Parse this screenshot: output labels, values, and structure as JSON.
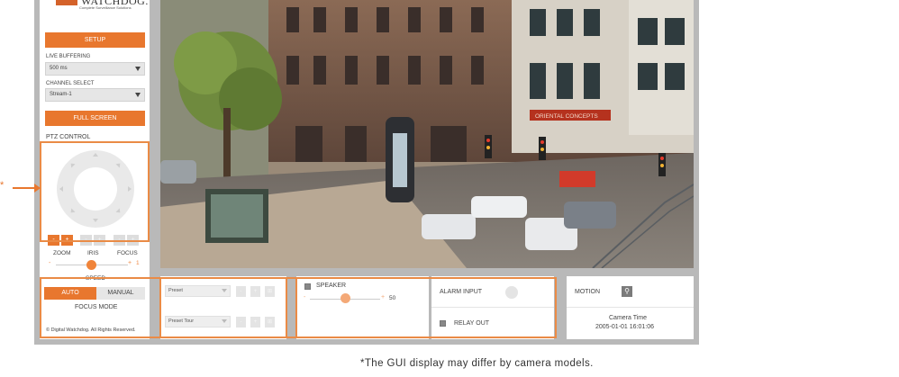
{
  "brand": {
    "name": "WATCHDOG.",
    "tagline": "Complete Surveillance Solutions"
  },
  "sidebar": {
    "setup_label": "SETUP",
    "live_buffering": {
      "label": "LIVE BUFFERING",
      "value": "500 ms"
    },
    "channel_select": {
      "label": "CHANNEL SELECT",
      "value": "Stream-1"
    },
    "fullscreen_label": "FULL SCREEN",
    "ptz_label": "PTZ CONTROL",
    "zoom": {
      "label": "ZOOM",
      "minus": "-",
      "plus": "+"
    },
    "iris": {
      "label": "IRIS",
      "minus": "-",
      "plus": "+"
    },
    "focus": {
      "label": "FOCUS",
      "minus": "-",
      "plus": "+"
    },
    "speed": {
      "label": "SPEED",
      "minus": "-",
      "plus": "+",
      "value": "1"
    },
    "focus_mode": {
      "label": "FOCUS MODE",
      "auto": "AUTO",
      "manual": "MANUAL"
    },
    "copyright": "© Digital Watchdog. All Rights Reserved."
  },
  "bottom": {
    "preset": {
      "label": "Preset",
      "btn1": "-",
      "btn2": "+",
      "btn3": "⊞"
    },
    "preset_tour": {
      "label": "Preset Tour",
      "btn1": "-",
      "btn2": "+",
      "btn3": "⊞"
    },
    "speaker": {
      "label": "SPEAKER",
      "minus": "-",
      "plus": "+",
      "value": "50"
    },
    "alarm_input": {
      "label": "ALARM INPUT"
    },
    "relay_out": {
      "label": "RELAY OUT"
    },
    "motion": {
      "label": "MOTION"
    },
    "camera_time": {
      "label": "Camera Time",
      "value": "2005-01-01 16:01:06"
    }
  },
  "video": {
    "shop_sign": "ORIENTAL CONCEPTS"
  },
  "annotation": {
    "star": "*",
    "caption": "*The GUI display may differ by camera models."
  },
  "colors": {
    "accent": "#e8772e",
    "frame": "#b9b9b9",
    "highlight_box": "#ea8b46"
  }
}
